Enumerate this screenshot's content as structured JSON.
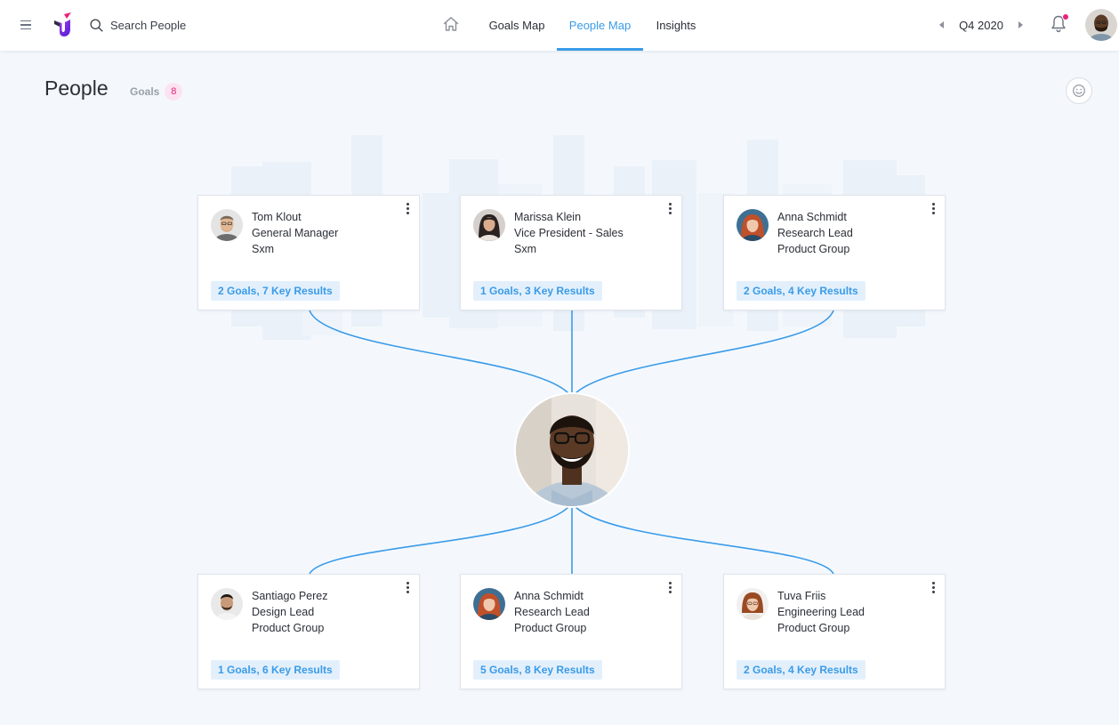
{
  "search": {
    "placeholder": "Search People"
  },
  "nav": {
    "tabs": [
      {
        "label": "Goals Map"
      },
      {
        "label": "People Map"
      },
      {
        "label": "Insights"
      }
    ],
    "active": "People Map"
  },
  "period": {
    "label": "Q4 2020"
  },
  "page": {
    "title": "People",
    "goals_label": "Goals",
    "goals_count": "8"
  },
  "colors": {
    "accent": "#3a9be8",
    "brand": "#7b2ff7",
    "notification": "#e8227a"
  },
  "managers": [
    {
      "name": "Tom Klout",
      "role": "General Manager",
      "group": "Sxm",
      "stats": "2 Goals, 7 Key Results"
    },
    {
      "name": "Marissa Klein",
      "role": "Vice President - Sales",
      "group": "Sxm",
      "stats": "1 Goals, 3 Key Results"
    },
    {
      "name": "Anna Schmidt",
      "role": "Research Lead",
      "group": "Product Group",
      "stats": "2 Goals, 4 Key Results"
    }
  ],
  "reports": [
    {
      "name": "Santiago Perez",
      "role": "Design Lead",
      "group": "Product Group",
      "stats": "1 Goals, 6 Key Results"
    },
    {
      "name": "Anna Schmidt",
      "role": "Research Lead",
      "group": "Product Group",
      "stats": "5 Goals, 8 Key Results"
    },
    {
      "name": "Tuva Friis",
      "role": "Engineering Lead",
      "group": "Product Group",
      "stats": "2 Goals, 4 Key Results"
    }
  ]
}
